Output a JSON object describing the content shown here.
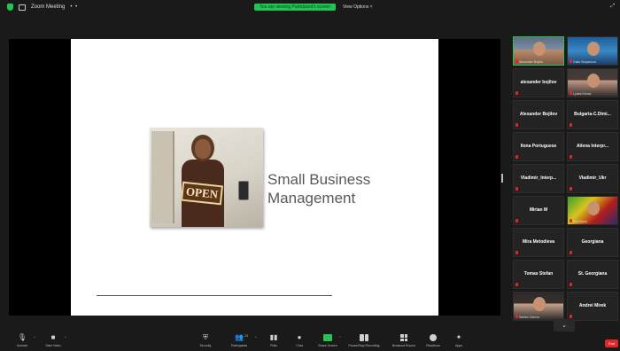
{
  "top_bar": {
    "meeting_label": "Zoom Meeting",
    "sharing_banner": "You are viewing Participant's screen",
    "view_options": "View Options"
  },
  "slide": {
    "title_line1": "Small Business",
    "title_line2": "Management",
    "sign_text": "OPEN"
  },
  "participants": [
    {
      "name": "Alexander Bojilov",
      "video": true,
      "active": true
    },
    {
      "name": "Galia Stoyanova",
      "video": true
    },
    {
      "name": "alexander bojilov",
      "video": false
    },
    {
      "name": "Lyuba Kirova",
      "video": true
    },
    {
      "name": "Alexander Bojilov",
      "video": false
    },
    {
      "name": "Bulgaria-C.Dimi...",
      "video": false
    },
    {
      "name": "Ilona Portuguese",
      "video": false
    },
    {
      "name": "Ailena Interpr...",
      "video": false
    },
    {
      "name": "Vladimir_Interp...",
      "video": false
    },
    {
      "name": "Vladimir_Ukr",
      "video": false
    },
    {
      "name": "Mirian M",
      "video": false
    },
    {
      "name": "Snezhana",
      "video": true
    },
    {
      "name": "Mira Metodieva",
      "video": false
    },
    {
      "name": "Georgiana",
      "video": false
    },
    {
      "name": "Tomas Stefan",
      "video": false
    },
    {
      "name": "St. Georgiana",
      "video": false
    },
    {
      "name": "Stefani Zareva",
      "video": true
    },
    {
      "name": "Andrei Mirek",
      "video": false
    }
  ],
  "toolbar": {
    "unmute": "Unmute",
    "start_video": "Start Video",
    "security": "Security",
    "participants": "Participants",
    "participants_count": "24",
    "polls": "Polls",
    "chat": "Chat",
    "share_screen": "Share Screen",
    "pause_share": "Pause/Stop Recording",
    "breakout": "Breakout Rooms",
    "reactions": "Reactions",
    "apps": "Apps",
    "end": "End"
  }
}
